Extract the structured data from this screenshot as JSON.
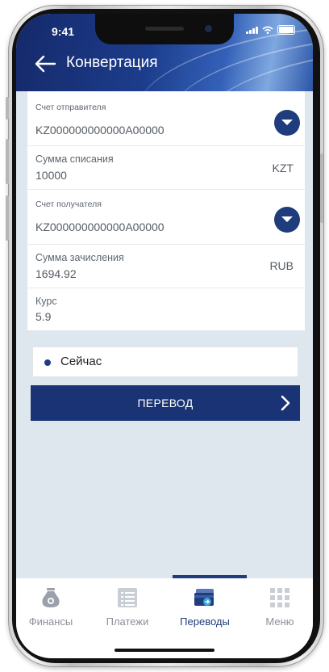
{
  "status_bar": {
    "time": "9:41"
  },
  "header": {
    "title": "Конвертация"
  },
  "form": {
    "sender_account": {
      "label": "Счет отправителя",
      "value": "KZ000000000000A00000"
    },
    "debit_amount": {
      "label": "Сумма списания",
      "value": "10000",
      "currency": "KZT"
    },
    "recipient_account": {
      "label": "Счет получателя",
      "value": "KZ000000000000A00000"
    },
    "credit_amount": {
      "label": "Сумма зачисления",
      "value": "1694.92",
      "currency": "RUB"
    },
    "rate": {
      "label": "Курс",
      "value": "5.9"
    }
  },
  "timing": {
    "selected_option": "Сейчас"
  },
  "actions": {
    "transfer_label": "ПЕРЕВОД"
  },
  "tabbar": {
    "active_tab": "Переводы",
    "tabs": [
      {
        "label": "Финансы",
        "icon": "money-bag-icon"
      },
      {
        "label": "Платежи",
        "icon": "payments-list-icon"
      },
      {
        "label": "Переводы",
        "icon": "transfer-card-icon"
      },
      {
        "label": "Меню",
        "icon": "menu-grid-icon"
      }
    ]
  },
  "colors": {
    "brand_dark": "#1a3375",
    "brand": "#1f3c7d",
    "screen_bg": "#dfe7ee",
    "inactive_tab": "#8a9099"
  }
}
